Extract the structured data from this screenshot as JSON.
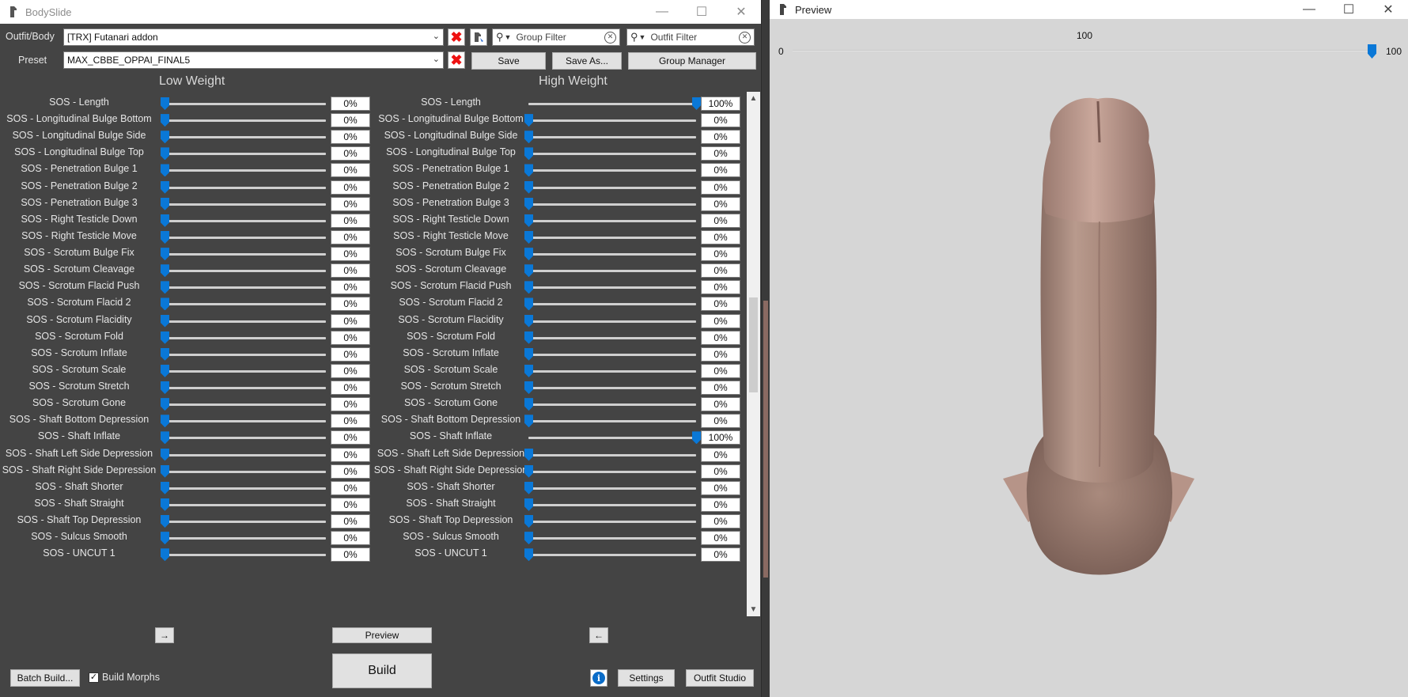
{
  "bodyslide": {
    "title": "BodySlide",
    "outfit_label": "Outfit/Body",
    "outfit_value": "[TRX] Futanari addon",
    "preset_label": "Preset",
    "preset_value": "MAX_CBBE_OPPAI_FINAL5",
    "group_filter_placeholder": "Group Filter",
    "outfit_filter_placeholder": "Outfit Filter",
    "save_label": "Save",
    "save_as_label": "Save As...",
    "group_manager_label": "Group Manager",
    "low_weight_label": "Low Weight",
    "high_weight_label": "High Weight",
    "sliders": [
      {
        "name": "SOS - Length",
        "low": "0%",
        "high": "100%",
        "low_pct": 0,
        "high_pct": 100
      },
      {
        "name": "SOS - Longitudinal Bulge Bottom",
        "low": "0%",
        "high": "0%",
        "low_pct": 0,
        "high_pct": 0
      },
      {
        "name": "SOS - Longitudinal Bulge Side",
        "low": "0%",
        "high": "0%",
        "low_pct": 0,
        "high_pct": 0
      },
      {
        "name": "SOS - Longitudinal Bulge Top",
        "low": "0%",
        "high": "0%",
        "low_pct": 0,
        "high_pct": 0
      },
      {
        "name": "SOS - Penetration Bulge 1",
        "low": "0%",
        "high": "0%",
        "low_pct": 0,
        "high_pct": 0
      },
      {
        "name": "SOS - Penetration Bulge 2",
        "low": "0%",
        "high": "0%",
        "low_pct": 0,
        "high_pct": 0
      },
      {
        "name": "SOS - Penetration Bulge 3",
        "low": "0%",
        "high": "0%",
        "low_pct": 0,
        "high_pct": 0
      },
      {
        "name": "SOS - Right Testicle Down",
        "low": "0%",
        "high": "0%",
        "low_pct": 0,
        "high_pct": 0
      },
      {
        "name": "SOS - Right Testicle Move",
        "low": "0%",
        "high": "0%",
        "low_pct": 0,
        "high_pct": 0
      },
      {
        "name": "SOS - Scrotum Bulge Fix",
        "low": "0%",
        "high": "0%",
        "low_pct": 0,
        "high_pct": 0
      },
      {
        "name": "SOS - Scrotum Cleavage",
        "low": "0%",
        "high": "0%",
        "low_pct": 0,
        "high_pct": 0
      },
      {
        "name": "SOS - Scrotum Flacid Push",
        "low": "0%",
        "high": "0%",
        "low_pct": 0,
        "high_pct": 0
      },
      {
        "name": "SOS - Scrotum Flacid 2",
        "low": "0%",
        "high": "0%",
        "low_pct": 0,
        "high_pct": 0
      },
      {
        "name": "SOS - Scrotum Flacidity",
        "low": "0%",
        "high": "0%",
        "low_pct": 0,
        "high_pct": 0
      },
      {
        "name": "SOS - Scrotum Fold",
        "low": "0%",
        "high": "0%",
        "low_pct": 0,
        "high_pct": 0
      },
      {
        "name": "SOS - Scrotum Inflate",
        "low": "0%",
        "high": "0%",
        "low_pct": 0,
        "high_pct": 0
      },
      {
        "name": "SOS - Scrotum Scale",
        "low": "0%",
        "high": "0%",
        "low_pct": 0,
        "high_pct": 0
      },
      {
        "name": "SOS - Scrotum Stretch",
        "low": "0%",
        "high": "0%",
        "low_pct": 0,
        "high_pct": 0
      },
      {
        "name": "SOS - Scrotum Gone",
        "low": "0%",
        "high": "0%",
        "low_pct": 0,
        "high_pct": 0
      },
      {
        "name": "SOS - Shaft Bottom Depression",
        "low": "0%",
        "high": "0%",
        "low_pct": 0,
        "high_pct": 0
      },
      {
        "name": "SOS - Shaft Inflate",
        "low": "0%",
        "high": "100%",
        "low_pct": 0,
        "high_pct": 100
      },
      {
        "name": "SOS - Shaft Left Side Depression",
        "low": "0%",
        "high": "0%",
        "low_pct": 0,
        "high_pct": 0
      },
      {
        "name": "SOS - Shaft Right Side Depression",
        "low": "0%",
        "high": "0%",
        "low_pct": 0,
        "high_pct": 0
      },
      {
        "name": "SOS - Shaft Shorter",
        "low": "0%",
        "high": "0%",
        "low_pct": 0,
        "high_pct": 0
      },
      {
        "name": "SOS - Shaft Straight",
        "low": "0%",
        "high": "0%",
        "low_pct": 0,
        "high_pct": 0
      },
      {
        "name": "SOS - Shaft Top Depression",
        "low": "0%",
        "high": "0%",
        "low_pct": 0,
        "high_pct": 0
      },
      {
        "name": "SOS - Sulcus Smooth",
        "low": "0%",
        "high": "0%",
        "low_pct": 0,
        "high_pct": 0
      },
      {
        "name": "SOS - UNCUT 1",
        "low": "0%",
        "high": "0%",
        "low_pct": 0,
        "high_pct": 0
      }
    ],
    "copy_right_arrow": "→",
    "copy_left_arrow": "←",
    "preview_label": "Preview",
    "build_label": "Build",
    "batch_build_label": "Batch Build...",
    "build_morphs_label": "Build Morphs",
    "build_morphs_checked": true,
    "settings_label": "Settings",
    "outfit_studio_label": "Outfit Studio",
    "accent_color": "#0a78d7"
  },
  "preview": {
    "title": "Preview",
    "slider_min": "0",
    "slider_max": "100",
    "slider_value": "100",
    "slider_pct": 100
  },
  "icons": {
    "app": "bodyslide-app-icon",
    "clear": "red-x-icon",
    "outfit_picker": "outfit-picker-icon",
    "search": "search-icon",
    "info": "info-icon"
  }
}
